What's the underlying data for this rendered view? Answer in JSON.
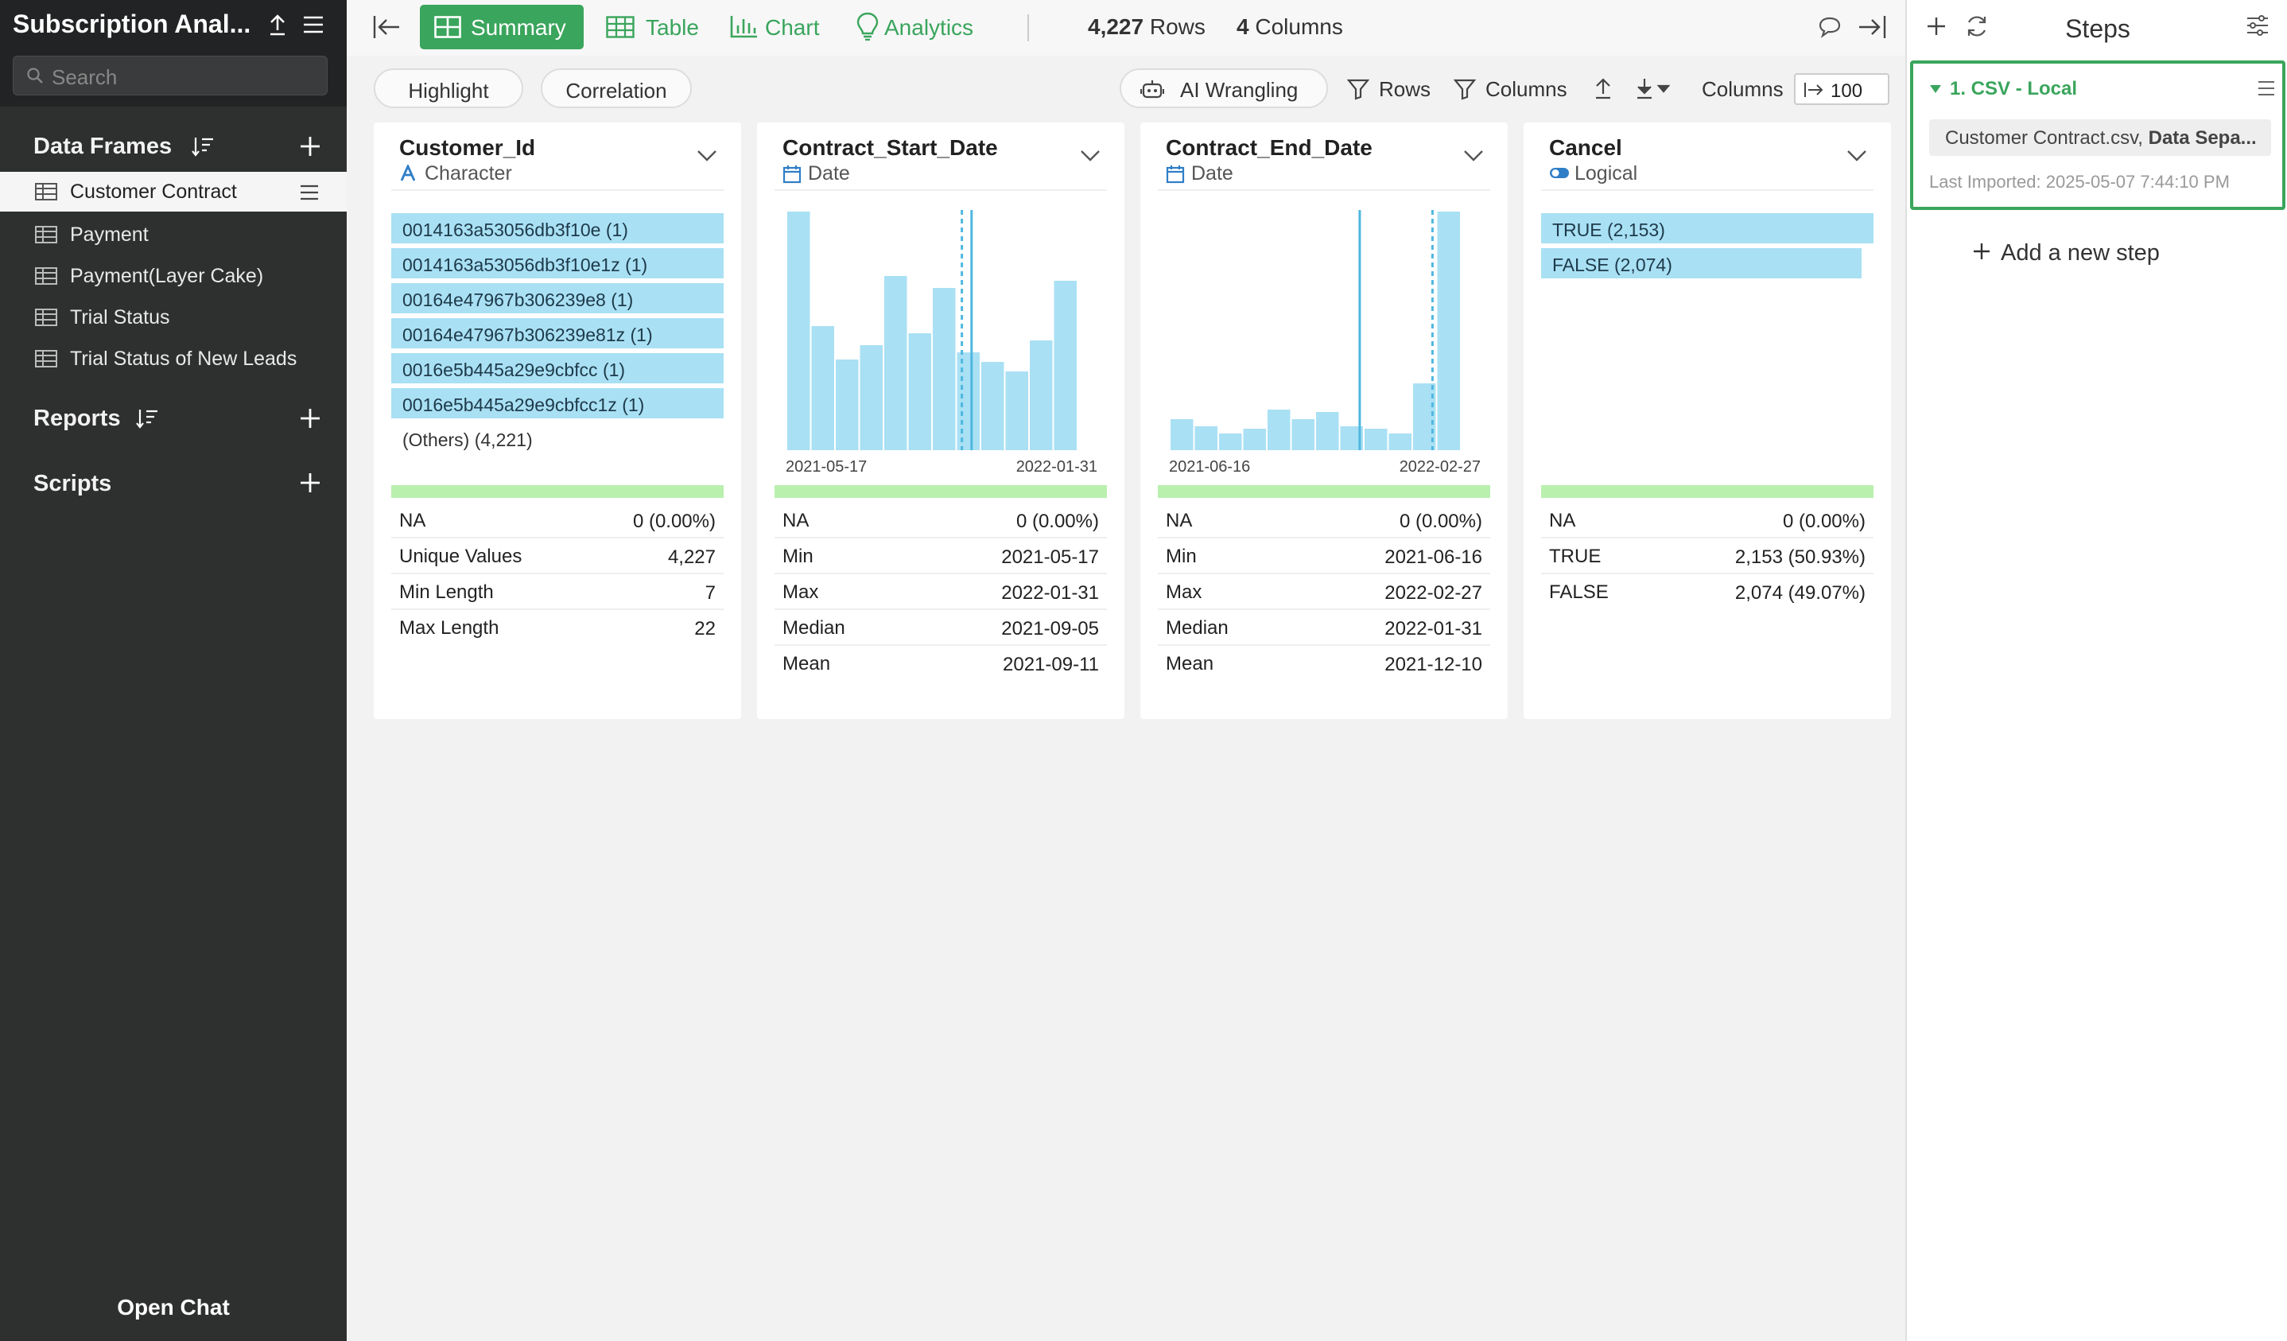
{
  "app": {
    "title": "Subscription Anal..."
  },
  "sidebar": {
    "search_placeholder": "Search",
    "data_frames_label": "Data Frames",
    "items": [
      {
        "label": "Customer Contract"
      },
      {
        "label": "Payment"
      },
      {
        "label": "Payment(Layer Cake)"
      },
      {
        "label": "Trial Status"
      },
      {
        "label": "Trial Status of New Leads"
      }
    ],
    "reports_label": "Reports",
    "scripts_label": "Scripts",
    "open_chat": "Open Chat"
  },
  "toolbar": {
    "tabs": [
      {
        "label": "Summary",
        "icon": "grid-icon"
      },
      {
        "label": "Table",
        "icon": "table-icon"
      },
      {
        "label": "Chart",
        "icon": "bar-chart-icon"
      },
      {
        "label": "Analytics",
        "icon": "lightbulb-icon"
      }
    ],
    "rows_value": "4,227",
    "rows_label": "Rows",
    "cols_value": "4",
    "cols_label": "Columns"
  },
  "subbar": {
    "highlight": "Highlight",
    "correlation": "Correlation",
    "ai_wrangling": "AI Wrangling",
    "rows_filter": "Rows",
    "columns_filter": "Columns",
    "columns_label": "Columns",
    "columns_value": "100"
  },
  "colors": {
    "accent": "#3aa55c",
    "bar": "#a9e0f4",
    "green_bar": "#b9f0ae"
  },
  "cards": {
    "c0": {
      "name": "Customer_Id",
      "type": "Character",
      "top_values": [
        "0014163a53056db3f10e (1)",
        "0014163a53056db3f10e1z (1)",
        "00164e47967b306239e8 (1)",
        "00164e47967b306239e81z (1)",
        "0016e5b445a29e9cbfcc (1)",
        "0016e5b445a29e9cbfcc1z (1)"
      ],
      "others": "(Others) (4,221)",
      "stats": [
        {
          "k": "NA",
          "v": "0 (0.00%)"
        },
        {
          "k": "Unique Values",
          "v": "4,227"
        },
        {
          "k": "Min Length",
          "v": "7"
        },
        {
          "k": "Max Length",
          "v": "22"
        }
      ]
    },
    "c1": {
      "name": "Contract_Start_Date",
      "type": "Date",
      "axis_min": "2021-05-17",
      "axis_max": "2022-01-31",
      "stats": [
        {
          "k": "NA",
          "v": "0 (0.00%)"
        },
        {
          "k": "Min",
          "v": "2021-05-17"
        },
        {
          "k": "Max",
          "v": "2022-01-31"
        },
        {
          "k": "Median",
          "v": "2021-09-05"
        },
        {
          "k": "Mean",
          "v": "2021-09-11"
        }
      ]
    },
    "c2": {
      "name": "Contract_End_Date",
      "type": "Date",
      "axis_min": "2021-06-16",
      "axis_max": "2022-02-27",
      "stats": [
        {
          "k": "NA",
          "v": "0 (0.00%)"
        },
        {
          "k": "Min",
          "v": "2021-06-16"
        },
        {
          "k": "Max",
          "v": "2022-02-27"
        },
        {
          "k": "Median",
          "v": "2022-01-31"
        },
        {
          "k": "Mean",
          "v": "2021-12-10"
        }
      ]
    },
    "c3": {
      "name": "Cancel",
      "type": "Logical",
      "top_values": [
        "TRUE (2,153)",
        "FALSE (2,074)"
      ],
      "stats": [
        {
          "k": "NA",
          "v": "0 (0.00%)"
        },
        {
          "k": "TRUE",
          "v": "2,153 (50.93%)"
        },
        {
          "k": "FALSE",
          "v": "2,074 (49.07%)"
        }
      ]
    }
  },
  "chart_data": [
    {
      "type": "bar",
      "title": "Contract_Start_Date",
      "x_range": [
        "2021-05-17",
        "2022-01-31"
      ],
      "values": [
        100,
        52,
        38,
        44,
        73,
        49,
        68,
        41,
        37,
        33,
        46,
        71
      ],
      "median": "2021-09-05",
      "mean": "2021-09-11"
    },
    {
      "type": "bar",
      "title": "Contract_End_Date",
      "x_range": [
        "2021-06-16",
        "2022-02-27"
      ],
      "values": [
        13,
        10,
        7,
        9,
        17,
        13,
        16,
        10,
        9,
        7,
        28,
        100
      ],
      "median": "2022-01-31",
      "mean": "2021-12-10"
    }
  ],
  "bar_fractions": {
    "cancel_true": 1.0,
    "cancel_false": 0.963
  },
  "steps": {
    "title": "Steps",
    "step1_name": "1. CSV - Local",
    "step1_file": "Customer Contract.csv,",
    "step1_detail": "Data Sepa...",
    "step1_time": "Last Imported: 2025-05-07 7:44:10 PM",
    "add_step": "Add a new step"
  }
}
